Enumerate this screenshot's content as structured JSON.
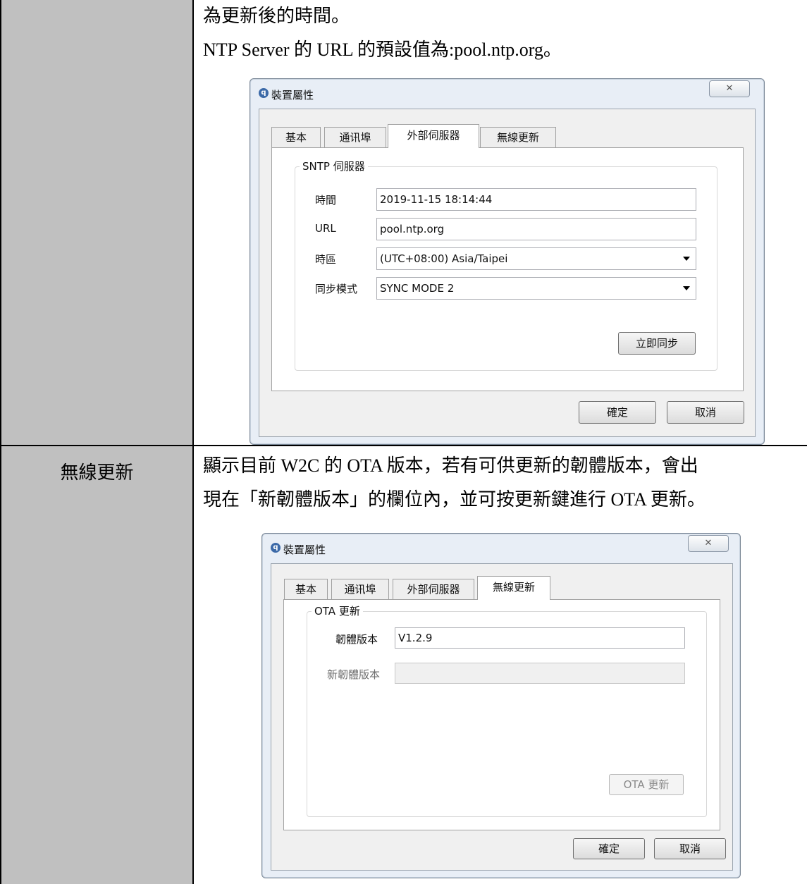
{
  "row1": {
    "lines": [
      "為更新後的時間。",
      "NTP Server 的 URL 的預設值為:pool.ntp.org。"
    ]
  },
  "row2": {
    "label": "無線更新",
    "lines": [
      "顯示目前 W2C 的 OTA 版本，若有可供更新的韌體版本，會出",
      "現在「新韌體版本」的欄位內，並可按更新鍵進行 OTA 更新。"
    ]
  },
  "dialog1": {
    "title": "裝置屬性",
    "close": "✕",
    "tabs": [
      "基本",
      "通讯埠",
      "外部伺服器",
      "無線更新"
    ],
    "active_tab": "外部伺服器",
    "group_title": "SNTP 伺服器",
    "fields": {
      "time_label": "時間",
      "time_value": "2019-11-15 18:14:44",
      "url_label": "URL",
      "url_value": "pool.ntp.org",
      "tz_label": "時區",
      "tz_value": "(UTC+08:00) Asia/Taipei",
      "sync_label": "同步模式",
      "sync_value": "SYNC MODE 2"
    },
    "sync_now": "立即同步",
    "ok": "確定",
    "cancel": "取消"
  },
  "dialog2": {
    "title": "裝置屬性",
    "close": "✕",
    "tabs": [
      "基本",
      "通讯埠",
      "外部伺服器",
      "無線更新"
    ],
    "active_tab": "無線更新",
    "group_title": "OTA 更新",
    "fields": {
      "fw_label": "韌體版本",
      "fw_value": "V1.2.9",
      "new_fw_label": "新韌體版本",
      "new_fw_value": ""
    },
    "ota_button": "OTA 更新",
    "ok": "確定",
    "cancel": "取消"
  }
}
